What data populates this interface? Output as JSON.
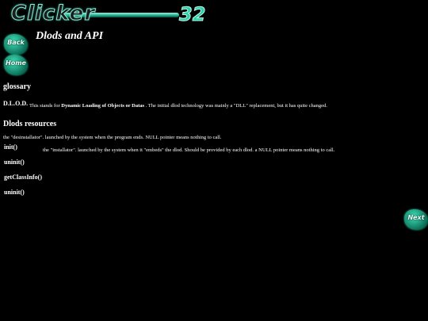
{
  "logo": {
    "word": "Clicker",
    "number": "32"
  },
  "nav": {
    "back_label": "Back",
    "home_label": "Home",
    "next_label": "Next"
  },
  "page": {
    "title": "Dlods and API"
  },
  "glossary": {
    "heading": "glossary",
    "term": "D.L.O.D.",
    "definition_pre": "This stands for ",
    "definition_bold": "Dynamic Loading of Objects or Datas",
    "definition_post": " . The initial dlod technology was mainly a \"DLL\" replacement, but it has quite changed."
  },
  "resources": {
    "heading": "Dlods resources",
    "descriptions": [
      "the \"desinstallator\". launched by the system when the program ends. NULL pointer means nothing to call.",
      "the \"installator\". launched by the system when it \"embeds\" the dlod. Should be provided by each dlod. a NULL pointer means nothing to call."
    ],
    "functions": [
      "init()",
      "uninit()",
      "getClassInfo()",
      "uninit()"
    ]
  }
}
